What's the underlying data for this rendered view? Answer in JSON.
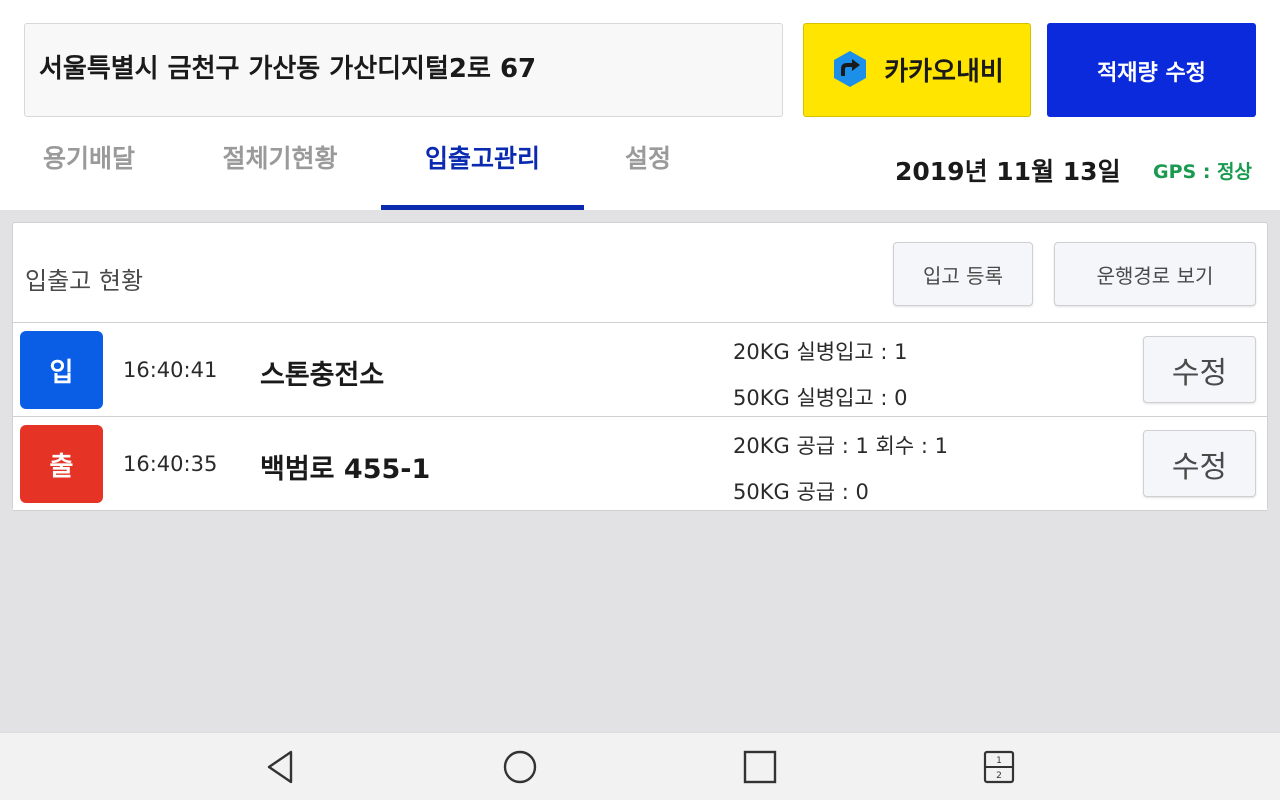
{
  "header": {
    "address": "서울특별시 금천구 가산동 가산디지털2로 67",
    "kakao_navi_label": "카카오내비",
    "load_edit_label": "적재량 수정",
    "date": "2019년 11월 13일",
    "gps_status": "GPS : 정상"
  },
  "tabs": [
    {
      "label": "용기배달",
      "active": false
    },
    {
      "label": "절체기현황",
      "active": false
    },
    {
      "label": "입출고관리",
      "active": true
    },
    {
      "label": "설정",
      "active": false
    }
  ],
  "panel": {
    "title": "입출고 현황",
    "register_label": "입고 등록",
    "route_label": "운행경로 보기"
  },
  "records": [
    {
      "badge": "입",
      "badge_color": "#0a5ee6",
      "time": "16:40:41",
      "place": "스톤충전소",
      "line1": "20KG 실병입고 : 1",
      "line2": "50KG 실병입고 : 0",
      "edit_label": "수정"
    },
    {
      "badge": "출",
      "badge_color": "#e53425",
      "time": "16:40:35",
      "place": "백범로 455-1",
      "line1": "20KG 공급 : 1 회수 : 1",
      "line2": "50KG 공급 : 0",
      "edit_label": "수정"
    }
  ],
  "colors": {
    "accent_blue": "#0a2ab0",
    "kakao_yellow": "#ffe500",
    "gps_green": "#1a9a50"
  },
  "navbar": {
    "icons": [
      "back-icon",
      "home-icon",
      "recents-icon",
      "dual-window-icon"
    ]
  }
}
